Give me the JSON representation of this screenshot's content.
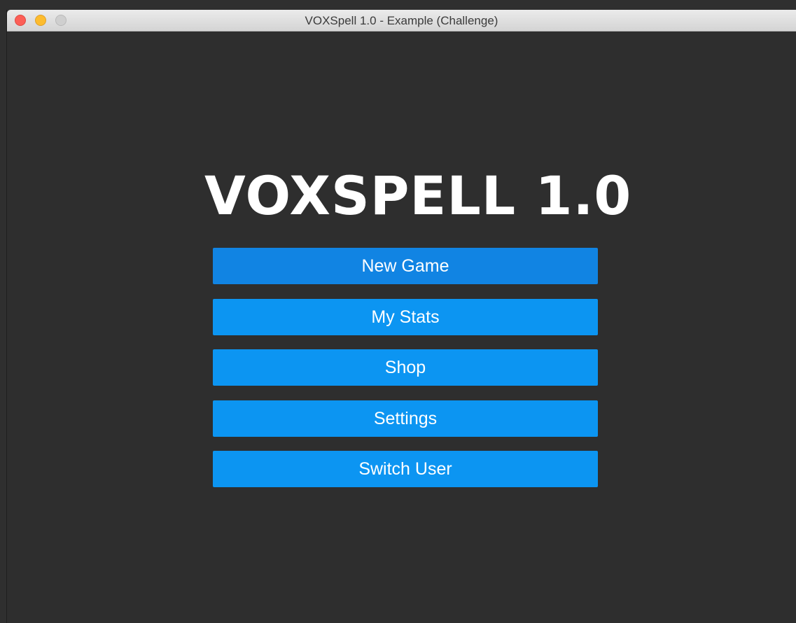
{
  "window": {
    "title": "VOXSpell 1.0 - Example (Challenge)"
  },
  "main": {
    "app_title": "VOXSPELL 1.0",
    "buttons": [
      {
        "label": "New Game"
      },
      {
        "label": "My Stats"
      },
      {
        "label": "Shop"
      },
      {
        "label": "Settings"
      },
      {
        "label": "Switch User"
      }
    ]
  },
  "colors": {
    "background": "#2e2e2e",
    "button": "#0c95f2",
    "button_focused": "#1184e3",
    "text": "#ffffff"
  }
}
